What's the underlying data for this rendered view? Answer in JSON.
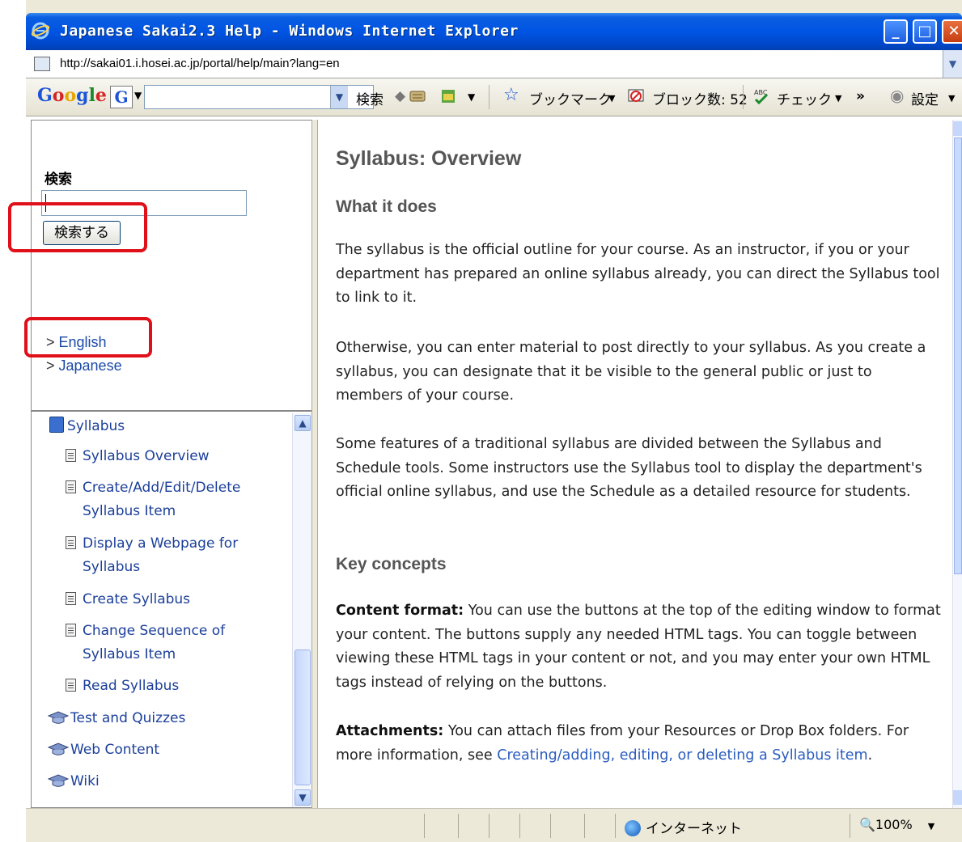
{
  "window": {
    "title": "Japanese Sakai2.3 Help - Windows Internet Explorer",
    "url": "http://sakai01.i.hosei.ac.jp/portal/help/main?lang=en"
  },
  "google_toolbar": {
    "logo": "Google",
    "g_button": "G",
    "search_button": "検索",
    "bookmarks": "ブックマーク",
    "blocked_count": "ブロック数: 52",
    "check": "チェック",
    "more": "»",
    "settings": "設定"
  },
  "left_search": {
    "label": "検索",
    "input_value": "",
    "button_label": "検索する",
    "languages": [
      "English",
      "Japanese"
    ]
  },
  "toc": {
    "items": [
      {
        "label": "Syllabus",
        "type": "book"
      },
      {
        "label": "Syllabus Overview",
        "type": "doc"
      },
      {
        "label": "Create/Add/Edit/Delete",
        "type": "doc"
      },
      {
        "label": "Syllabus Item",
        "type": "cont"
      },
      {
        "label": "Display a Webpage for",
        "type": "doc"
      },
      {
        "label": "Syllabus",
        "type": "cont"
      },
      {
        "label": "Create Syllabus",
        "type": "doc"
      },
      {
        "label": "Change Sequence of",
        "type": "doc"
      },
      {
        "label": "Syllabus Item",
        "type": "cont"
      },
      {
        "label": "Read Syllabus",
        "type": "doc"
      },
      {
        "label": "Test and Quizzes",
        "type": "grad"
      },
      {
        "label": "Web Content",
        "type": "grad"
      },
      {
        "label": "Wiki",
        "type": "grad"
      }
    ]
  },
  "main": {
    "title": "Syllabus: Overview",
    "what_it_does": "What it does",
    "para1": "The syllabus is the official outline for your course. As an instructor, if you or your department has prepared an online syllabus already, you can direct the Syllabus tool to link to it.",
    "para2": "Otherwise, you can enter material to post directly to your syllabus. As you create a syllabus, you can designate that it be visible to the general public or just to members of your course.",
    "para3": "Some features of a traditional syllabus are divided between the Syllabus and Schedule tools. Some instructors use the Syllabus tool to display the department's official online syllabus, and use the Schedule as a detailed resource for students.",
    "key_concepts": "Key concepts",
    "content_format_label": "Content format:",
    "content_format_text": "You can use the buttons at the top of the editing window to format your content. The buttons supply any needed HTML tags. You can toggle between viewing these HTML tags in your content or not, and you may enter your own HTML tags instead of relying on the buttons.",
    "attachments_label": "Attachments:",
    "attachments_text": "You can attach files from your Resources or Drop Box folders. For more information, see",
    "attachments_link": "Creating/adding, editing, or deleting a Syllabus item",
    "attachments_end": "."
  },
  "status": {
    "zone": "インターネット",
    "zoom": "100%"
  }
}
